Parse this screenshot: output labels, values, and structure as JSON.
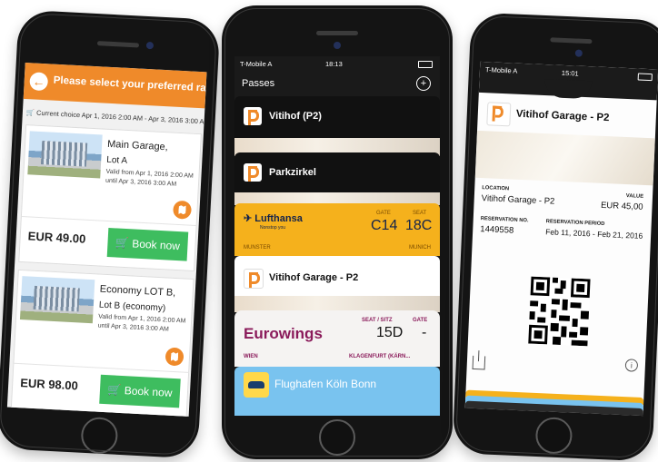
{
  "phone1": {
    "header_title": "Please select your preferred rate:",
    "current_choice": "Current choice Apr 1, 2016 2:00 AM - Apr 3, 2016 3:00 AM",
    "rates": [
      {
        "name": "Main Garage,",
        "sub": "Lot A",
        "valid1": "Valid from Apr 1, 2016 2:00 AM",
        "valid2": "until Apr 3, 2016 3:00 AM",
        "price": "EUR 49.00",
        "button": "Book now"
      },
      {
        "name": "Economy LOT B,",
        "sub": "Lot B (economy)",
        "valid1": "Valid from Apr 1, 2016 2:00 AM",
        "valid2": "until Apr 3, 2016 3:00 AM",
        "price": "EUR 98.00",
        "button": "Book now"
      }
    ]
  },
  "phone2": {
    "carrier": "T-Mobile A",
    "time": "18:13",
    "title": "Passes",
    "passes": [
      {
        "name": "Vitihof (P2)"
      },
      {
        "name": "Parkzirkel"
      }
    ],
    "lufthansa": {
      "logo": "Lufthansa",
      "tagline": "Nonstop you",
      "gate_label": "GATE",
      "gate": "C14",
      "seat_label": "SEAT",
      "seat": "18C",
      "from": "MUNSTER",
      "to": "MUNICH"
    },
    "garage_pass": "Vitihof Garage - P2",
    "eurowings": {
      "logo": "Eurowings",
      "seat_label": "SEAT / SITZ",
      "seat": "15D",
      "gate_label": "GATE",
      "gate": "-",
      "from": "WIEN",
      "to": "KLAGENFURT (KÄRN..."
    },
    "cologne": "Flughafen Köln Bonn"
  },
  "phone3": {
    "carrier": "T-Mobile A",
    "time": "15:01",
    "title": "Vitihof Garage - P2",
    "location_label": "LOCATION",
    "location": "Vitihof Garage - P2",
    "value_label": "VALUE",
    "value": "EUR 45,00",
    "res_no_label": "RESERVATION NO.",
    "res_no": "1449558",
    "period_label": "RESERVATION PERIOD",
    "period": "Feb 11, 2016 - Feb 21, 2016"
  },
  "colors": {
    "orange": "#ef8a2a",
    "green": "#3ebd5f",
    "lufthansa_yellow": "#f5b11c",
    "eurowings_magenta": "#8a1a5a",
    "sky_blue": "#79c3ef"
  }
}
